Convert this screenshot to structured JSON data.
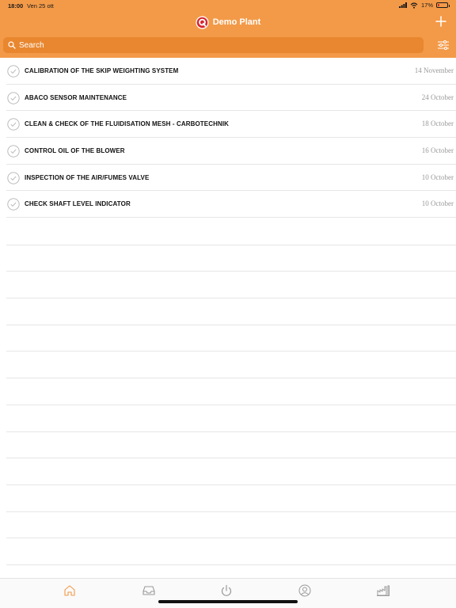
{
  "status": {
    "time": "18:00",
    "date": "Ven 25 ott",
    "battery": "17%",
    "battery_level": 0.17
  },
  "header": {
    "title": "Demo Plant",
    "brand_color": "#F39A48"
  },
  "search": {
    "placeholder": "Search"
  },
  "tasks": [
    {
      "title": "CALIBRATION OF THE SKIP WEIGHTING SYSTEM",
      "date": "14 November"
    },
    {
      "title": "ABACO SENSOR MAINTENANCE",
      "date": "24 October"
    },
    {
      "title": "CLEAN & CHECK OF THE FLUIDISATION MESH - CARBOTECHNIK",
      "date": "18 October"
    },
    {
      "title": "CONTROL OIL OF THE BLOWER",
      "date": "16 October"
    },
    {
      "title": "INSPECTION OF THE AIR/FUMES VALVE",
      "date": "10 October"
    },
    {
      "title": "CHECK SHAFT LEVEL INDICATOR",
      "date": "10 October"
    }
  ],
  "tabs": [
    {
      "icon": "home-icon",
      "active": true
    },
    {
      "icon": "inbox-icon",
      "active": false
    },
    {
      "icon": "power-icon",
      "active": false
    },
    {
      "icon": "user-icon",
      "active": false
    },
    {
      "icon": "plant-icon",
      "active": false
    }
  ]
}
